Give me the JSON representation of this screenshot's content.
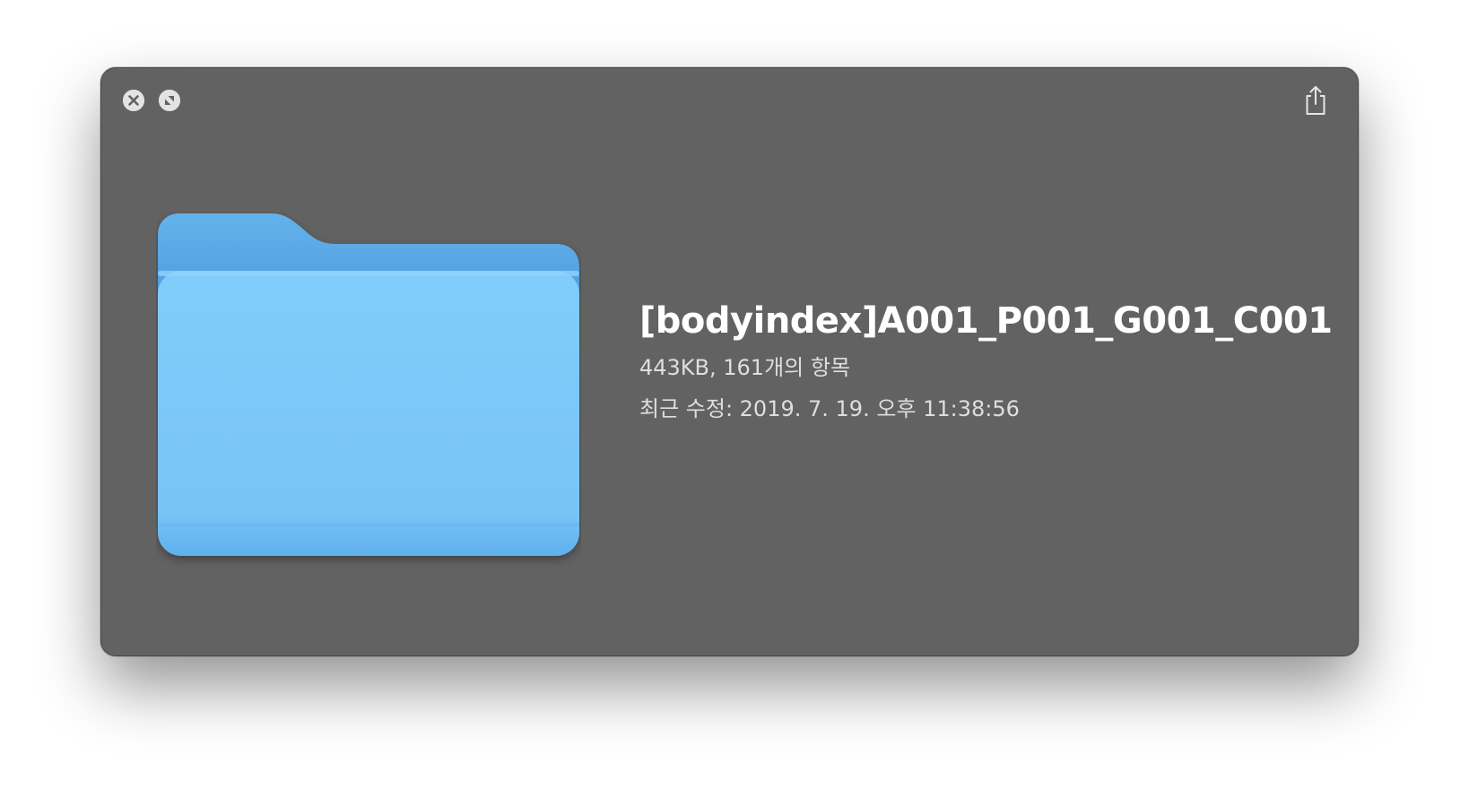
{
  "window": {
    "file_name": "[bodyindex]A001_P001_G001_C001",
    "size_and_count": "443KB, 161개의 항목",
    "modified": "최근 수정: 2019. 7. 19. 오후 11:38:56"
  },
  "controls": {
    "close_icon": "close-icon",
    "fullscreen_icon": "fullscreen-icon",
    "share_icon": "share-icon"
  },
  "colors": {
    "window_bg": "#626262",
    "folder_back": "#5aa9e6",
    "folder_front": "#7cc7f7"
  },
  "file_icon": "folder-icon"
}
